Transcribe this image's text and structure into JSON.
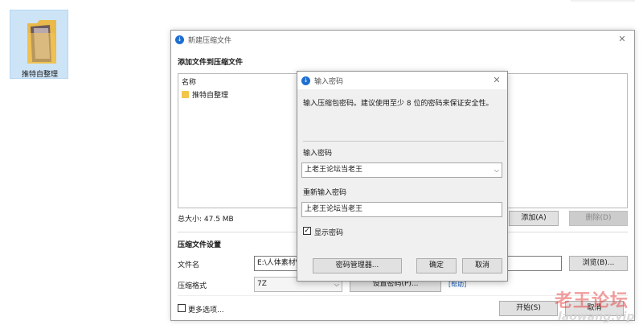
{
  "desktop": {
    "icon_label": "推特自整理"
  },
  "main_window": {
    "title": "新建压缩文件",
    "add_files_title": "添加文件到压缩文件",
    "list_header": "名称",
    "list_items": [
      "推特自整理"
    ],
    "total_size": "总大小: 47.5 MB",
    "add_button": "添加(A)",
    "delete_button": "删除(D)",
    "settings_title": "压缩文件设置",
    "filename_label": "文件名",
    "filename_value": "E:\\人体素材\\",
    "browse_button": "浏览(B)...",
    "format_label": "压缩格式",
    "format_value": "7Z",
    "set_password_button": "设置密码(P)...",
    "help_link": "[帮助]",
    "more_options_label": "更多选项...",
    "start_button": "开始(S)",
    "cancel_button": "取消"
  },
  "password_dialog": {
    "title": "输入密码",
    "description": "输入压缩包密码。建议使用至少 8 位的密码来保证安全性。",
    "password_label": "输入密码",
    "password_value": "上老王论坛当老王",
    "repeat_label": "重新输入密码",
    "repeat_value": "上老王论坛当老王",
    "show_password_label": "显示密码",
    "show_password_checked": true,
    "manager_button": "密码管理器...",
    "ok_button": "确定",
    "cancel_button": "取消"
  },
  "watermark": {
    "line1": "老王论坛",
    "line2": "laowang.vip"
  },
  "colors": {
    "accent": "#1e6fd0",
    "watermark": "#e54c4c"
  }
}
